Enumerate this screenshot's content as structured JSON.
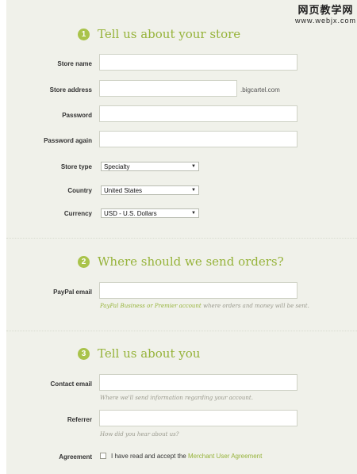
{
  "watermark": {
    "line1": "网页教学网",
    "line2": "www.webjx.com"
  },
  "section1": {
    "number": "1",
    "title": "Tell us about your store",
    "store_name_label": "Store name",
    "store_address_label": "Store address",
    "store_address_suffix": ".bigcartel.com",
    "password_label": "Password",
    "password_again_label": "Password again",
    "store_type_label": "Store type",
    "store_type_value": "Specialty",
    "country_label": "Country",
    "country_value": "United States",
    "currency_label": "Currency",
    "currency_value": "USD - U.S. Dollars"
  },
  "section2": {
    "number": "2",
    "title": "Where should we send orders?",
    "paypal_label": "PayPal email",
    "paypal_help_link": "PayPal Business or Premier account",
    "paypal_help_rest": " where orders and money will be sent."
  },
  "section3": {
    "number": "3",
    "title": "Tell us about you",
    "contact_label": "Contact email",
    "contact_help": "Where we'll send information regarding your account.",
    "referrer_label": "Referrer",
    "referrer_help": "How did you hear about us?",
    "agreement_label": "Agreement",
    "agreement_text": "I have read and accept the ",
    "agreement_link": "Merchant User Agreement"
  },
  "colors": {
    "accent": "#96b33a",
    "background": "#f0f1ea"
  }
}
